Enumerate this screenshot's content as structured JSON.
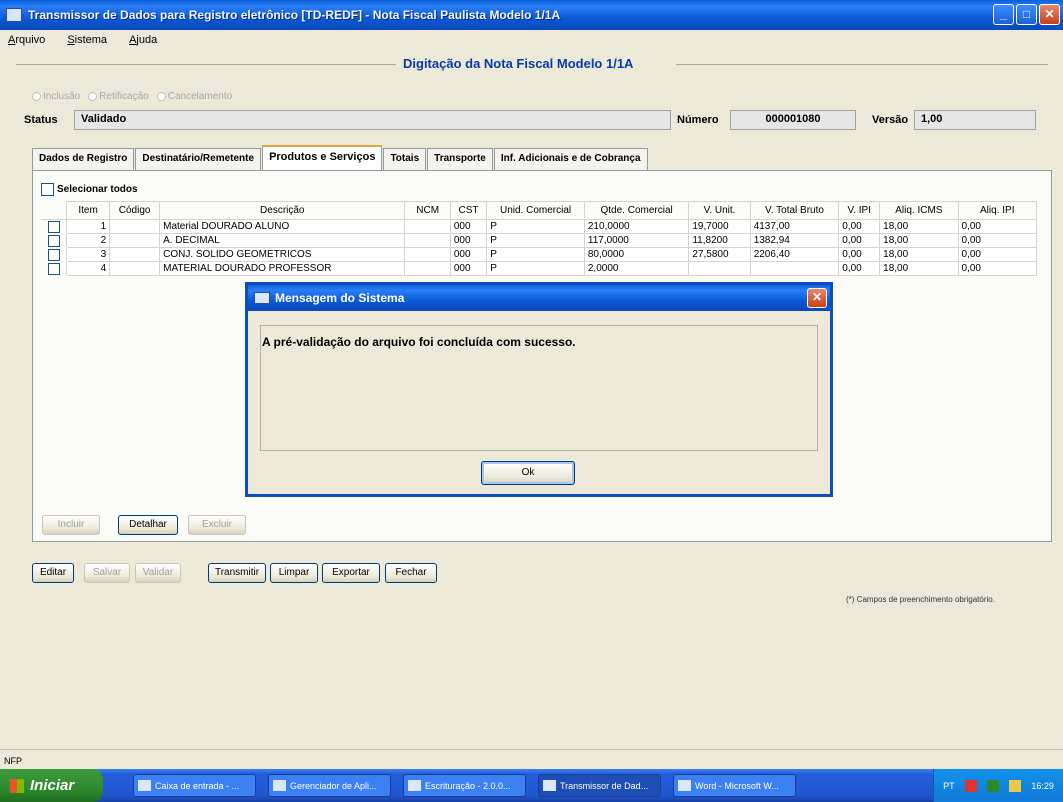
{
  "window": {
    "title": "Transmissor de Dados para Registro eletrônico [TD-REDF] - Nota Fiscal Paulista Modelo 1/1A"
  },
  "menu": [
    "Arquivo",
    "Sistema",
    "Ajuda"
  ],
  "page_title": "Digitação da Nota Fiscal Modelo 1/1A",
  "radios": [
    "Inclusão",
    "Retificação",
    "Cancelamento"
  ],
  "status": {
    "label": "Status",
    "value": "Validado"
  },
  "numero": {
    "label": "Número",
    "value": "000001080"
  },
  "versao": {
    "label": "Versão",
    "value": "1,00"
  },
  "tabs": [
    "Dados de Registro",
    "Destinatário/Remetente",
    "Produtos e Serviços",
    "Totais",
    "Transporte",
    "Inf. Adicionais e de Cobrança"
  ],
  "select_all_label": "Selecionar todos",
  "table": {
    "columns": [
      "Item",
      "Código",
      "Descrição",
      "NCM",
      "CST",
      "Unid. Comercial",
      "Qtde. Comercial",
      "V. Unit.",
      "V. Total Bruto",
      "V. IPI",
      "Aliq. ICMS",
      "Aliq. IPI"
    ],
    "rows": [
      [
        "1",
        "",
        "Material DOURADO ALUNO",
        "",
        "000",
        "P",
        "210,0000",
        "19,7000",
        "4137,00",
        "0,00",
        "18,00",
        "0,00"
      ],
      [
        "2",
        "",
        "A. DECIMAL",
        "",
        "000",
        "P",
        "117,0000",
        "11,8200",
        "1382,94",
        "0,00",
        "18,00",
        "0,00"
      ],
      [
        "3",
        "",
        "CONJ. SOLIDO GEOMETRICOS",
        "",
        "000",
        "P",
        "80,0000",
        "27,5800",
        "2206,40",
        "0,00",
        "18,00",
        "0,00"
      ],
      [
        "4",
        "",
        "MATERIAL DOURADO PROFESSOR",
        "",
        "000",
        "P",
        "2,0000",
        "",
        "",
        "0,00",
        "18,00",
        "0,00"
      ]
    ]
  },
  "item_buttons": {
    "incluir": "Incluir",
    "detalhar": "Detalhar",
    "excluir": "Excluir"
  },
  "action_buttons": {
    "editar": "Editar",
    "salvar": "Salvar",
    "validar": "Validar",
    "transmitir": "Transmitir",
    "limpar": "Limpar",
    "exportar": "Exportar",
    "fechar": "Fechar"
  },
  "footer_note": "(*) Campos de preenchimento obrigatório.",
  "statusbar_text": "NFP",
  "modal": {
    "title": "Mensagem do Sistema",
    "message": "A pré-validação do arquivo foi concluída com sucesso.",
    "ok_label": "Ok"
  },
  "taskbar": {
    "start_label": "Iniciar",
    "tasks": [
      "Caixa de entrada - ...",
      "Gerenciador de Apli...",
      "Escrituração - 2.0.0...",
      "Transmissor de Dad...",
      "Word - Microsoft W..."
    ],
    "tray_lang": "PT",
    "clock": "16:29"
  },
  "colors": {
    "accent": "#0a3aa6",
    "titlebar": "#0b5ad6",
    "active_tab": "#e8a33d"
  }
}
